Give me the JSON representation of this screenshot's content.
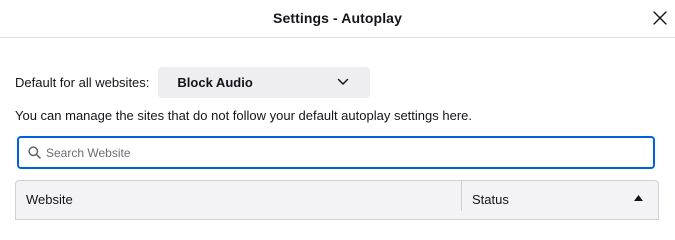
{
  "dialog": {
    "title": "Settings - Autoplay"
  },
  "icons": {
    "close": "close-icon",
    "chevron": "chevron-down-icon",
    "search": "search-icon",
    "sort": "sort-ascending-icon"
  },
  "default_setting": {
    "label": "Default for all websites:",
    "selected": "Block Audio"
  },
  "description": "You can manage the sites that do not follow your default autoplay settings here.",
  "search": {
    "placeholder": "Search Website",
    "value": ""
  },
  "table": {
    "columns": [
      "Website",
      "Status"
    ],
    "rows": []
  },
  "colors": {
    "focus_border": "#0061e0",
    "select_bg": "#eeeef0",
    "header_bg": "#f3f3f5"
  }
}
